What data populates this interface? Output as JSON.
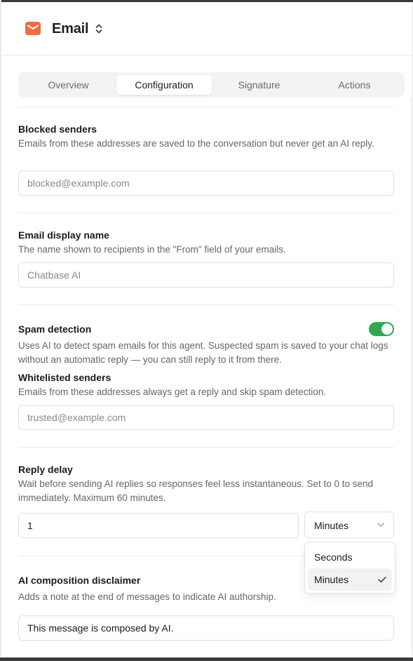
{
  "header": {
    "title": "Email",
    "icon": "mail-icon",
    "icon_color": "#F26B3A"
  },
  "tabs": [
    {
      "label": "Overview",
      "active": false
    },
    {
      "label": "Configuration",
      "active": true
    },
    {
      "label": "Signature",
      "active": false
    },
    {
      "label": "Actions",
      "active": false
    }
  ],
  "blocked_senders": {
    "label": "Blocked senders",
    "description": "Emails from these addresses are saved to the conversation but never get an AI reply.",
    "placeholder": "blocked@example.com"
  },
  "display_name": {
    "label": "Email display name",
    "description": "The name shown to recipients in the \"From\" field of your emails.",
    "placeholder": "Chatbase AI"
  },
  "spam_detection": {
    "label": "Spam detection",
    "enabled": true,
    "toggle_color": "#2FA84F",
    "description": "Uses AI to detect spam emails for this agent. Suspected spam is saved to your chat logs without an automatic reply — you can still reply to it from there."
  },
  "whitelisted_senders": {
    "label": "Whitelisted senders",
    "description": "Emails from these addresses always get a reply and skip spam detection.",
    "placeholder": "trusted@example.com"
  },
  "reply_delay": {
    "label": "Reply delay",
    "description": "Wait before sending AI replies so responses feel less instantaneous. Set to 0 to send immediately. Maximum 60 minutes.",
    "value": "1",
    "unit": "Minutes",
    "options": [
      "Seconds",
      "Minutes"
    ]
  },
  "disclaimer": {
    "label": "AI composition disclaimer",
    "description": "Adds a note at the end of messages to indicate AI authorship.",
    "value": "This message is composed by AI."
  }
}
